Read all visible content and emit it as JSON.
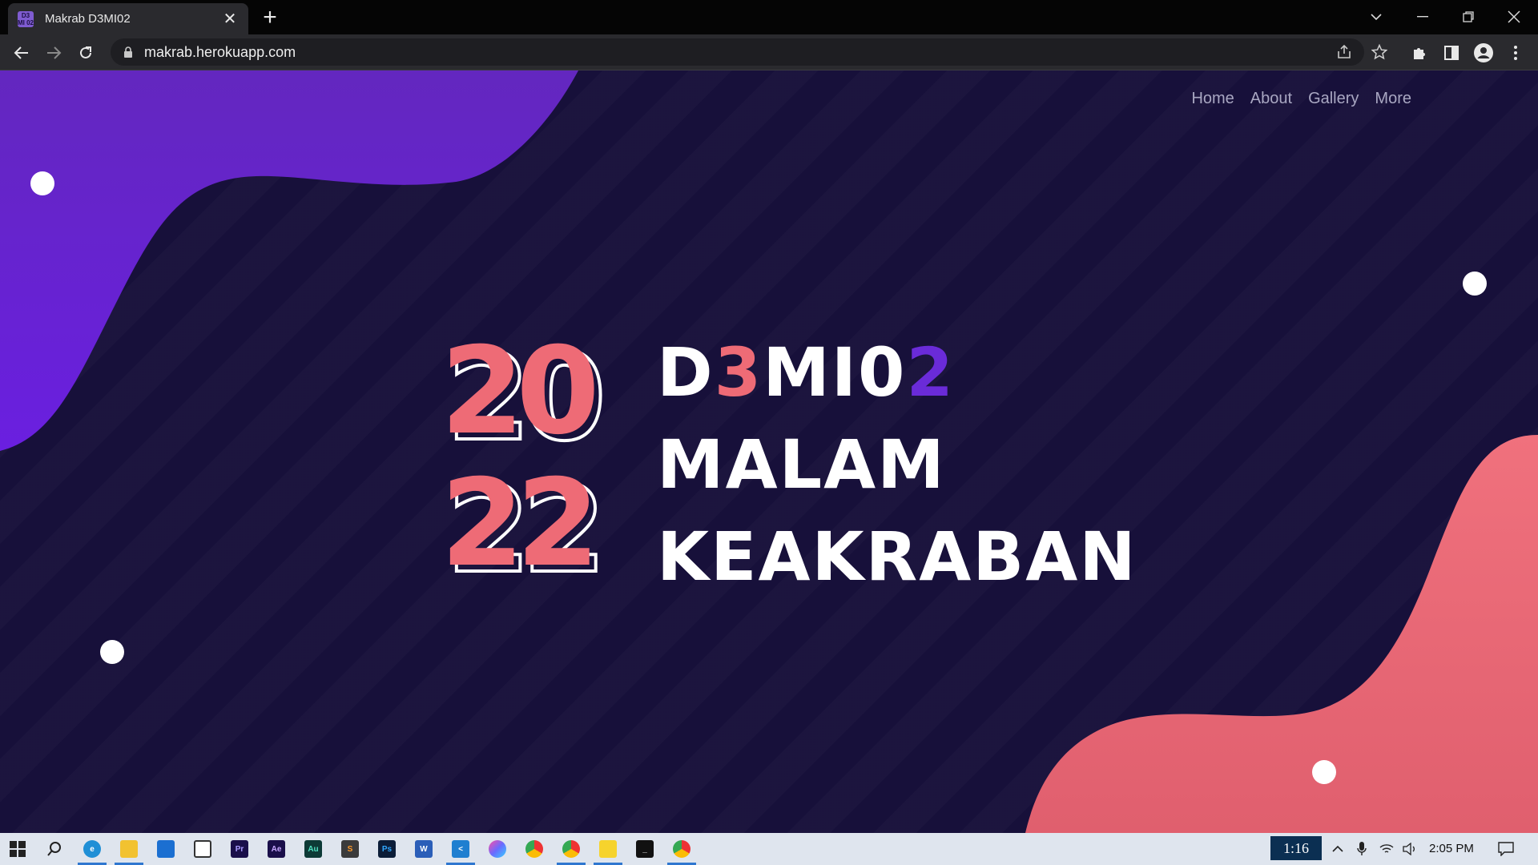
{
  "browser": {
    "tab_title": "Makrab D3MI02",
    "tab_favicon_text": "D3 MI 02",
    "url": "makrab.herokuapp.com"
  },
  "site": {
    "nav": [
      "Home",
      "About",
      "Gallery",
      "More"
    ],
    "year_top": "20",
    "year_bottom": "22",
    "title_line1": {
      "part1": "D",
      "part2": "3",
      "part3": "MI0",
      "part4": "2"
    },
    "title_line2": "MALAM",
    "title_line3": "KEAKRABAN"
  },
  "taskbar": {
    "badge_time": "1:16",
    "clock": "2:05 PM",
    "apps": [
      "start-icon",
      "search-icon",
      "edge-icon",
      "file-explorer-icon",
      "mail-icon",
      "twitch-icon",
      "premiere-icon",
      "after-effects-icon",
      "audition-icon",
      "sublime-icon",
      "photoshop-icon",
      "word-icon",
      "vscode-icon",
      "color-app-icon",
      "chrome-icon",
      "chrome-canary-icon",
      "sticky-notes-icon",
      "terminal-icon",
      "chrome-active-icon"
    ]
  },
  "colors": {
    "page_bg": "#17103a",
    "blob_purple": "#6a2bd8",
    "blob_pink": "#ee6b76",
    "text_white": "#ffffff",
    "nav_text": "#a9a7c2"
  }
}
